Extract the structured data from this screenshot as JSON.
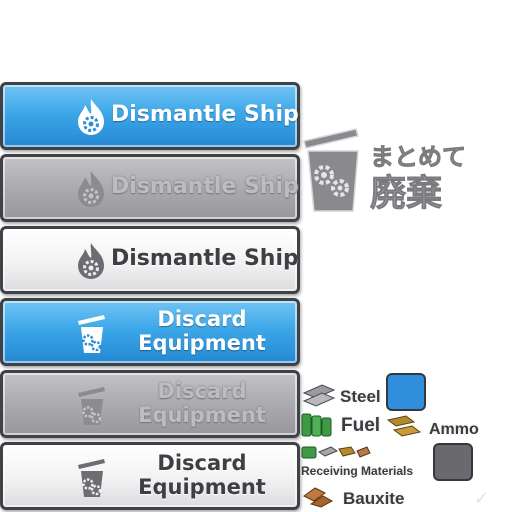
{
  "buttons": [
    {
      "label": "Dismantle Ship",
      "style": "blue",
      "icon": "flame-gear-icon"
    },
    {
      "label": "Dismantle Ship",
      "style": "gray",
      "icon": "flame-gear-icon"
    },
    {
      "label": "Dismantle Ship",
      "style": "white",
      "icon": "flame-gear-icon"
    },
    {
      "label_line1": "Discard",
      "label_line2": "Equipment",
      "style": "blue",
      "icon": "trash-gear-icon"
    },
    {
      "label_line1": "Discard",
      "label_line2": "Equipment",
      "style": "gray",
      "icon": "trash-gear-icon"
    },
    {
      "label_line1": "Discard",
      "label_line2": "Equipment",
      "style": "white",
      "icon": "trash-gear-icon"
    }
  ],
  "logo": {
    "text_line1": "まとめて",
    "text_line2": "廃棄",
    "icon": "trash-gear-logo-icon"
  },
  "resources": {
    "steel": "Steel",
    "fuel": "Fuel",
    "ammo": "Ammo",
    "receiving_materials": "Receiving Materials",
    "bauxite": "Bauxite"
  },
  "colors": {
    "blue_button": "#3da7e8",
    "gray_button": "#a9a9ad",
    "white_button": "#f2f2f3",
    "border": "#3f4348",
    "blue_swatch": "#2f8fdc",
    "gray_swatch": "#6a6a6e"
  }
}
